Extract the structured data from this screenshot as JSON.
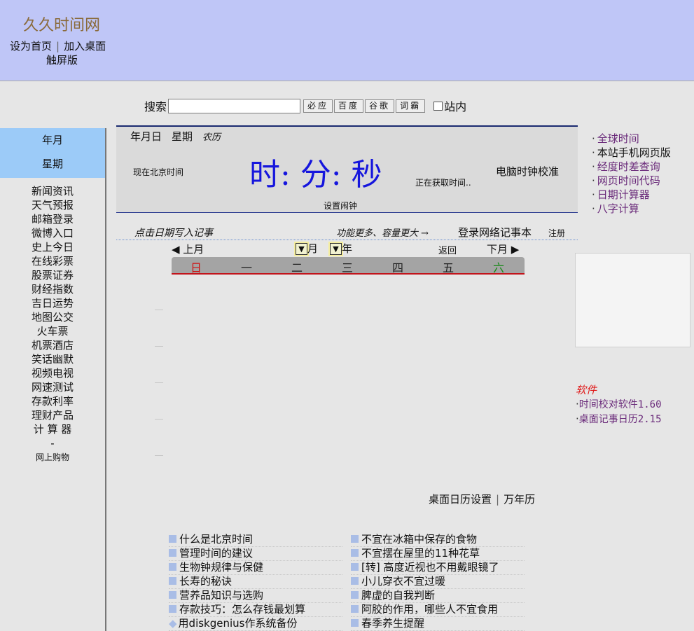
{
  "header": {
    "site_title": "久久时间网",
    "set_home": "设为首页",
    "add_desktop": "加入桌面",
    "separator": "|",
    "touch_version": "触屏版"
  },
  "search": {
    "label": "搜索",
    "value": "",
    "buttons": [
      "必应",
      "百度",
      "谷歌",
      "词霸"
    ],
    "site_only": "站内"
  },
  "left": {
    "date_line1": "年月",
    "date_line2": "星期",
    "nav": [
      "新闻资讯",
      "天气预报",
      "邮箱登录",
      "微博入口",
      "史上今日",
      "在线彩票",
      "股票证券",
      "财经指数",
      "吉日运势",
      "地图公交",
      "火车票",
      "机票酒店",
      "笑话幽默",
      "视频电视",
      "网速测试",
      "存款利率",
      "理财产品",
      "计 算 器"
    ],
    "dash": "-",
    "shopping": "网上购物"
  },
  "clock": {
    "date_ymd": "年月日",
    "weekday": "星期",
    "lunar": "农历",
    "beijing_label": "现在北京时间",
    "time_display": "时: 分: 秒",
    "fetching": "正在获取时间..",
    "calibrate": "电脑时钟校准",
    "alarm": "设置闹钟"
  },
  "notes": {
    "click_write": "点击日期写入记事",
    "more_features": "功能更多、容量更大",
    "arrow": "→",
    "login": "登录网络记事本",
    "register": "注册"
  },
  "calendar": {
    "prev": "◀ 上月",
    "month_suffix": "月",
    "year_suffix": "年",
    "back": "返回",
    "next": "下月 ▶",
    "weekdays": [
      "日",
      "一",
      "二",
      "三",
      "四",
      "五",
      "六"
    ],
    "weekday_colors": [
      "#d01010",
      "#222222",
      "#222222",
      "#222222",
      "#222222",
      "#222222",
      "#1a8a1a"
    ],
    "desktop_settings": "桌面日历设置",
    "separator": "|",
    "perpetual": "万年历"
  },
  "right": {
    "links": [
      "全球时间",
      "本站手机网页版",
      "经度时差查询",
      "网页时间代码",
      "日期计算器",
      "八字计算"
    ],
    "software_title": "软件",
    "software": [
      "时间校对软件1.60",
      "桌面记事日历2.15"
    ]
  },
  "articles": {
    "left": [
      "什么是北京时间",
      "管理时间的建议",
      "生物钟规律与保健",
      "长寿的秘诀",
      "营养品知识与选购",
      "存款技巧：怎么存钱最划算",
      "用diskgenius作系统备份"
    ],
    "right": [
      "不宜在冰箱中保存的食物",
      "不宜摆在屋里的11种花草",
      "[转] 高度近视也不用戴眼镜了",
      "小儿穿衣不宜过暖",
      "脾虚的自我判断",
      "阿胶的作用，哪些人不宜食用",
      "春季养生提醒"
    ]
  }
}
